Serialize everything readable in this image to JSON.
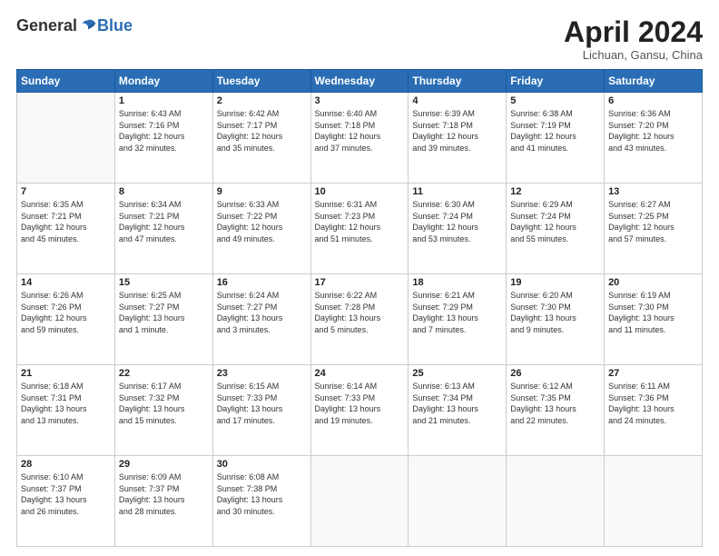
{
  "header": {
    "logo_general": "General",
    "logo_blue": "Blue",
    "month_title": "April 2024",
    "location": "Lichuan, Gansu, China"
  },
  "days_of_week": [
    "Sunday",
    "Monday",
    "Tuesday",
    "Wednesday",
    "Thursday",
    "Friday",
    "Saturday"
  ],
  "weeks": [
    [
      {
        "day": "",
        "info": ""
      },
      {
        "day": "1",
        "info": "Sunrise: 6:43 AM\nSunset: 7:16 PM\nDaylight: 12 hours\nand 32 minutes."
      },
      {
        "day": "2",
        "info": "Sunrise: 6:42 AM\nSunset: 7:17 PM\nDaylight: 12 hours\nand 35 minutes."
      },
      {
        "day": "3",
        "info": "Sunrise: 6:40 AM\nSunset: 7:18 PM\nDaylight: 12 hours\nand 37 minutes."
      },
      {
        "day": "4",
        "info": "Sunrise: 6:39 AM\nSunset: 7:18 PM\nDaylight: 12 hours\nand 39 minutes."
      },
      {
        "day": "5",
        "info": "Sunrise: 6:38 AM\nSunset: 7:19 PM\nDaylight: 12 hours\nand 41 minutes."
      },
      {
        "day": "6",
        "info": "Sunrise: 6:36 AM\nSunset: 7:20 PM\nDaylight: 12 hours\nand 43 minutes."
      }
    ],
    [
      {
        "day": "7",
        "info": "Sunrise: 6:35 AM\nSunset: 7:21 PM\nDaylight: 12 hours\nand 45 minutes."
      },
      {
        "day": "8",
        "info": "Sunrise: 6:34 AM\nSunset: 7:21 PM\nDaylight: 12 hours\nand 47 minutes."
      },
      {
        "day": "9",
        "info": "Sunrise: 6:33 AM\nSunset: 7:22 PM\nDaylight: 12 hours\nand 49 minutes."
      },
      {
        "day": "10",
        "info": "Sunrise: 6:31 AM\nSunset: 7:23 PM\nDaylight: 12 hours\nand 51 minutes."
      },
      {
        "day": "11",
        "info": "Sunrise: 6:30 AM\nSunset: 7:24 PM\nDaylight: 12 hours\nand 53 minutes."
      },
      {
        "day": "12",
        "info": "Sunrise: 6:29 AM\nSunset: 7:24 PM\nDaylight: 12 hours\nand 55 minutes."
      },
      {
        "day": "13",
        "info": "Sunrise: 6:27 AM\nSunset: 7:25 PM\nDaylight: 12 hours\nand 57 minutes."
      }
    ],
    [
      {
        "day": "14",
        "info": "Sunrise: 6:26 AM\nSunset: 7:26 PM\nDaylight: 12 hours\nand 59 minutes."
      },
      {
        "day": "15",
        "info": "Sunrise: 6:25 AM\nSunset: 7:27 PM\nDaylight: 13 hours\nand 1 minute."
      },
      {
        "day": "16",
        "info": "Sunrise: 6:24 AM\nSunset: 7:27 PM\nDaylight: 13 hours\nand 3 minutes."
      },
      {
        "day": "17",
        "info": "Sunrise: 6:22 AM\nSunset: 7:28 PM\nDaylight: 13 hours\nand 5 minutes."
      },
      {
        "day": "18",
        "info": "Sunrise: 6:21 AM\nSunset: 7:29 PM\nDaylight: 13 hours\nand 7 minutes."
      },
      {
        "day": "19",
        "info": "Sunrise: 6:20 AM\nSunset: 7:30 PM\nDaylight: 13 hours\nand 9 minutes."
      },
      {
        "day": "20",
        "info": "Sunrise: 6:19 AM\nSunset: 7:30 PM\nDaylight: 13 hours\nand 11 minutes."
      }
    ],
    [
      {
        "day": "21",
        "info": "Sunrise: 6:18 AM\nSunset: 7:31 PM\nDaylight: 13 hours\nand 13 minutes."
      },
      {
        "day": "22",
        "info": "Sunrise: 6:17 AM\nSunset: 7:32 PM\nDaylight: 13 hours\nand 15 minutes."
      },
      {
        "day": "23",
        "info": "Sunrise: 6:15 AM\nSunset: 7:33 PM\nDaylight: 13 hours\nand 17 minutes."
      },
      {
        "day": "24",
        "info": "Sunrise: 6:14 AM\nSunset: 7:33 PM\nDaylight: 13 hours\nand 19 minutes."
      },
      {
        "day": "25",
        "info": "Sunrise: 6:13 AM\nSunset: 7:34 PM\nDaylight: 13 hours\nand 21 minutes."
      },
      {
        "day": "26",
        "info": "Sunrise: 6:12 AM\nSunset: 7:35 PM\nDaylight: 13 hours\nand 22 minutes."
      },
      {
        "day": "27",
        "info": "Sunrise: 6:11 AM\nSunset: 7:36 PM\nDaylight: 13 hours\nand 24 minutes."
      }
    ],
    [
      {
        "day": "28",
        "info": "Sunrise: 6:10 AM\nSunset: 7:37 PM\nDaylight: 13 hours\nand 26 minutes."
      },
      {
        "day": "29",
        "info": "Sunrise: 6:09 AM\nSunset: 7:37 PM\nDaylight: 13 hours\nand 28 minutes."
      },
      {
        "day": "30",
        "info": "Sunrise: 6:08 AM\nSunset: 7:38 PM\nDaylight: 13 hours\nand 30 minutes."
      },
      {
        "day": "",
        "info": ""
      },
      {
        "day": "",
        "info": ""
      },
      {
        "day": "",
        "info": ""
      },
      {
        "day": "",
        "info": ""
      }
    ]
  ]
}
